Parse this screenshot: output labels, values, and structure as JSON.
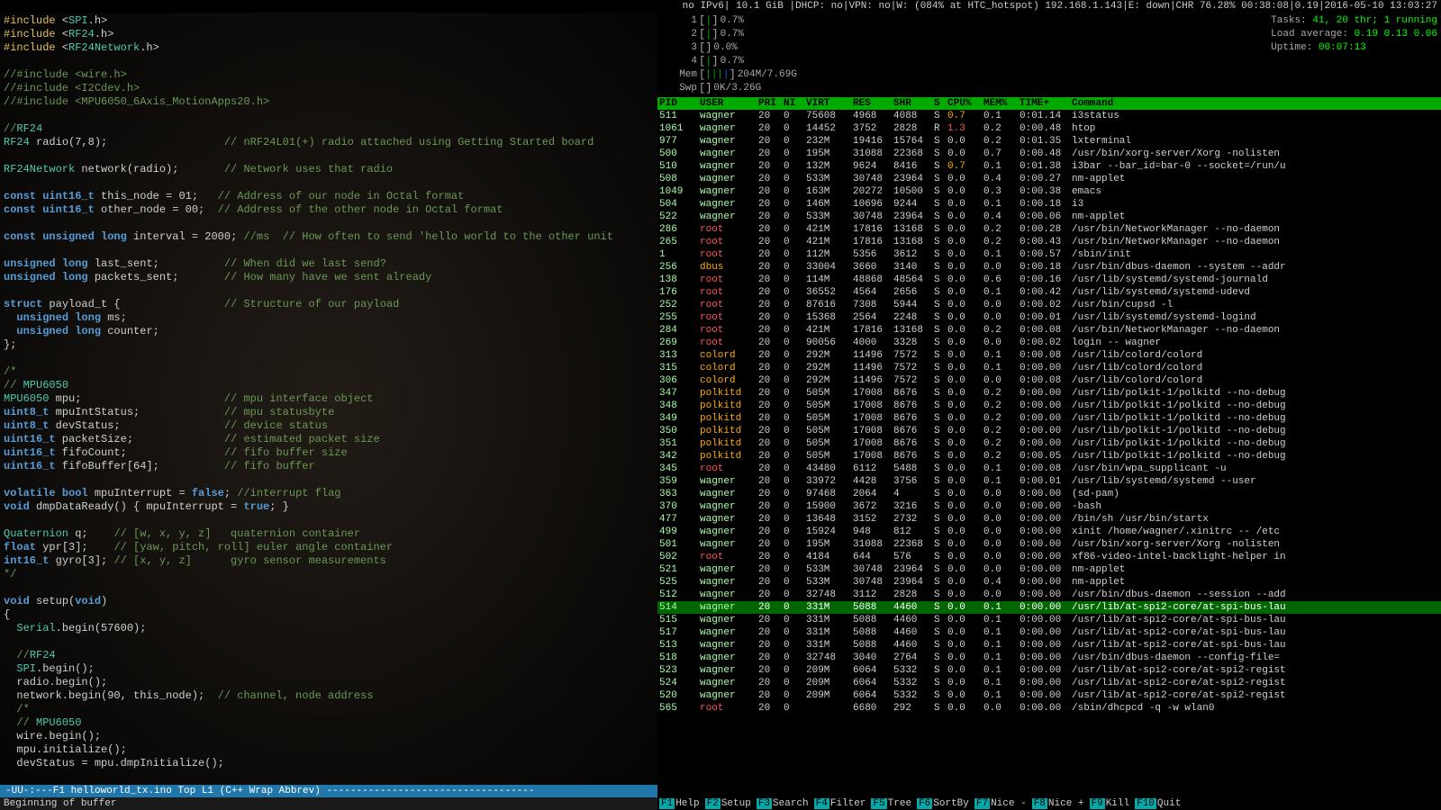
{
  "statusBar": {
    "text": "no IPv6| 10.1 GiB |DHCP: no|VPN: no|W: (084% at HTC_hotspot) 192.168.1.143|E: down|CHR 76.28% 00:38:08|0.19|2016-05-10 13:03:27"
  },
  "htop": {
    "meters": [
      {
        "id": 1,
        "value": "0.7%"
      },
      {
        "id": 2,
        "value": "0.7%"
      },
      {
        "id": 3,
        "value": "0.0%"
      },
      {
        "id": 4,
        "value": "0.7%"
      },
      {
        "mem": "Mem",
        "memVal": "204M/7.69G"
      },
      {
        "swp": "Swp",
        "swpVal": "0K/3.26G"
      }
    ],
    "info": {
      "tasks": "Tasks: 41, 20 thr; 1 running",
      "load": "Load average: 0.19 0.13 0.06",
      "uptime": "Uptime: 00:07:13"
    },
    "columns": [
      "PID",
      "USER",
      "PRI",
      "NI",
      "VIRT",
      "RES",
      "SHR",
      "S",
      "CPU%",
      "MEM%",
      "TIME+",
      "Command"
    ],
    "rows": [
      {
        "pid": "511",
        "user": "wagner",
        "pri": "20",
        "ni": "0",
        "virt": "75608",
        "res": "4968",
        "shr": "4088",
        "s": "S",
        "cpu": "0.7",
        "mem": "0.1",
        "time": "0:01.14",
        "cmd": "i3status"
      },
      {
        "pid": "1061",
        "user": "wagner",
        "pri": "20",
        "ni": "0",
        "virt": "14452",
        "res": "3752",
        "shr": "2828",
        "s": "R",
        "cpu": "1.3",
        "mem": "0.2",
        "time": "0:00.48",
        "cmd": "htop"
      },
      {
        "pid": "977",
        "user": "wagner",
        "pri": "20",
        "ni": "0",
        "virt": "232M",
        "res": "19416",
        "shr": "15764",
        "s": "S",
        "cpu": "0.0",
        "mem": "0.2",
        "time": "0:01.35",
        "cmd": "lxterminal"
      },
      {
        "pid": "500",
        "user": "wagner",
        "pri": "20",
        "ni": "0",
        "virt": "195M",
        "res": "31088",
        "shr": "22368",
        "s": "S",
        "cpu": "0.0",
        "mem": "0.7",
        "time": "0:00.48",
        "cmd": "/usr/bin/xorg-server/Xorg -nolisten"
      },
      {
        "pid": "510",
        "user": "wagner",
        "pri": "20",
        "ni": "0",
        "virt": "132M",
        "res": "9624",
        "shr": "8416",
        "s": "S",
        "cpu": "0.7",
        "mem": "0.1",
        "time": "0:01.38",
        "cmd": "i3bar --bar_id=bar-0 --socket=/run/u"
      },
      {
        "pid": "508",
        "user": "wagner",
        "pri": "20",
        "ni": "0",
        "virt": "533M",
        "res": "30748",
        "shr": "23964",
        "s": "S",
        "cpu": "0.0",
        "mem": "0.4",
        "time": "0:00.27",
        "cmd": "nm-applet"
      },
      {
        "pid": "1049",
        "user": "wagner",
        "pri": "20",
        "ni": "0",
        "virt": "163M",
        "res": "20272",
        "shr": "10500",
        "s": "S",
        "cpu": "0.0",
        "mem": "0.3",
        "time": "0:00.38",
        "cmd": "emacs"
      },
      {
        "pid": "504",
        "user": "wagner",
        "pri": "20",
        "ni": "0",
        "virt": "146M",
        "res": "10696",
        "shr": "9244",
        "s": "S",
        "cpu": "0.0",
        "mem": "0.1",
        "time": "0:00.18",
        "cmd": "i3"
      },
      {
        "pid": "522",
        "user": "wagner",
        "pri": "20",
        "ni": "0",
        "virt": "533M",
        "res": "30748",
        "shr": "23964",
        "s": "S",
        "cpu": "0.0",
        "mem": "0.4",
        "time": "0:00.06",
        "cmd": "nm-applet"
      },
      {
        "pid": "286",
        "user": "root",
        "pri": "20",
        "ni": "0",
        "virt": "421M",
        "res": "17816",
        "shr": "13168",
        "s": "S",
        "cpu": "0.0",
        "mem": "0.2",
        "time": "0:00.28",
        "cmd": "/usr/bin/NetworkManager --no-daemon"
      },
      {
        "pid": "265",
        "user": "root",
        "pri": "20",
        "ni": "0",
        "virt": "421M",
        "res": "17816",
        "shr": "13168",
        "s": "S",
        "cpu": "0.0",
        "mem": "0.2",
        "time": "0:00.43",
        "cmd": "/usr/bin/NetworkManager --no-daemon"
      },
      {
        "pid": "1",
        "user": "root",
        "pri": "20",
        "ni": "0",
        "virt": "112M",
        "res": "5356",
        "shr": "3612",
        "s": "S",
        "cpu": "0.0",
        "mem": "0.1",
        "time": "0:00.57",
        "cmd": "/sbin/init"
      },
      {
        "pid": "256",
        "user": "dbus",
        "pri": "20",
        "ni": "0",
        "virt": "33004",
        "res": "3660",
        "shr": "3140",
        "s": "S",
        "cpu": "0.0",
        "mem": "0.0",
        "time": "0:00.18",
        "cmd": "/usr/bin/dbus-daemon --system --addr"
      },
      {
        "pid": "138",
        "user": "root",
        "pri": "20",
        "ni": "0",
        "virt": "114M",
        "res": "48868",
        "shr": "48564",
        "s": "S",
        "cpu": "0.0",
        "mem": "0.6",
        "time": "0:00.16",
        "cmd": "/usr/lib/systemd/systemd-journald"
      },
      {
        "pid": "176",
        "user": "root",
        "pri": "20",
        "ni": "0",
        "virt": "36552",
        "res": "4564",
        "shr": "2656",
        "s": "S",
        "cpu": "0.0",
        "mem": "0.1",
        "time": "0:00.42",
        "cmd": "/usr/lib/systemd/systemd-udevd"
      },
      {
        "pid": "252",
        "user": "root",
        "pri": "20",
        "ni": "0",
        "virt": "87616",
        "res": "7308",
        "shr": "5944",
        "s": "S",
        "cpu": "0.0",
        "mem": "0.0",
        "time": "0:00.02",
        "cmd": "/usr/bin/cupsd -l"
      },
      {
        "pid": "255",
        "user": "root",
        "pri": "20",
        "ni": "0",
        "virt": "15368",
        "res": "2564",
        "shr": "2248",
        "s": "S",
        "cpu": "0.0",
        "mem": "0.0",
        "time": "0:00.01",
        "cmd": "/usr/lib/systemd/systemd-logind"
      },
      {
        "pid": "284",
        "user": "root",
        "pri": "20",
        "ni": "0",
        "virt": "421M",
        "res": "17816",
        "shr": "13168",
        "s": "S",
        "cpu": "0.0",
        "mem": "0.2",
        "time": "0:00.08",
        "cmd": "/usr/bin/NetworkManager --no-daemon"
      },
      {
        "pid": "269",
        "user": "root",
        "pri": "20",
        "ni": "0",
        "virt": "90056",
        "res": "4000",
        "shr": "3328",
        "s": "S",
        "cpu": "0.0",
        "mem": "0.0",
        "time": "0:00.02",
        "cmd": "login -- wagner"
      },
      {
        "pid": "313",
        "user": "colord",
        "pri": "20",
        "ni": "0",
        "virt": "292M",
        "res": "11496",
        "shr": "7572",
        "s": "S",
        "cpu": "0.0",
        "mem": "0.1",
        "time": "0:00.08",
        "cmd": "/usr/lib/colord/colord"
      },
      {
        "pid": "315",
        "user": "colord",
        "pri": "20",
        "ni": "0",
        "virt": "292M",
        "res": "11496",
        "shr": "7572",
        "s": "S",
        "cpu": "0.0",
        "mem": "0.1",
        "time": "0:00.00",
        "cmd": "/usr/lib/colord/colord"
      },
      {
        "pid": "306",
        "user": "colord",
        "pri": "20",
        "ni": "0",
        "virt": "292M",
        "res": "11496",
        "shr": "7572",
        "s": "S",
        "cpu": "0.0",
        "mem": "0.0",
        "time": "0:00.08",
        "cmd": "/usr/lib/colord/colord"
      },
      {
        "pid": "347",
        "user": "polkitd",
        "pri": "20",
        "ni": "0",
        "virt": "505M",
        "res": "17008",
        "shr": "8676",
        "s": "S",
        "cpu": "0.0",
        "mem": "0.2",
        "time": "0:00.00",
        "cmd": "/usr/lib/polkit-1/polkitd --no-debug"
      },
      {
        "pid": "348",
        "user": "polkitd",
        "pri": "20",
        "ni": "0",
        "virt": "505M",
        "res": "17008",
        "shr": "8676",
        "s": "S",
        "cpu": "0.0",
        "mem": "0.2",
        "time": "0:00.00",
        "cmd": "/usr/lib/polkit-1/polkitd --no-debug"
      },
      {
        "pid": "349",
        "user": "polkitd",
        "pri": "20",
        "ni": "0",
        "virt": "505M",
        "res": "17008",
        "shr": "8676",
        "s": "S",
        "cpu": "0.0",
        "mem": "0.2",
        "time": "0:00.00",
        "cmd": "/usr/lib/polkit-1/polkitd --no-debug"
      },
      {
        "pid": "350",
        "user": "polkitd",
        "pri": "20",
        "ni": "0",
        "virt": "505M",
        "res": "17008",
        "shr": "8676",
        "s": "S",
        "cpu": "0.0",
        "mem": "0.2",
        "time": "0:00.00",
        "cmd": "/usr/lib/polkit-1/polkitd --no-debug"
      },
      {
        "pid": "351",
        "user": "polkitd",
        "pri": "20",
        "ni": "0",
        "virt": "505M",
        "res": "17008",
        "shr": "8676",
        "s": "S",
        "cpu": "0.0",
        "mem": "0.2",
        "time": "0:00.00",
        "cmd": "/usr/lib/polkit-1/polkitd --no-debug"
      },
      {
        "pid": "342",
        "user": "polkitd",
        "pri": "20",
        "ni": "0",
        "virt": "505M",
        "res": "17008",
        "shr": "8676",
        "s": "S",
        "cpu": "0.0",
        "mem": "0.2",
        "time": "0:00.05",
        "cmd": "/usr/lib/polkit-1/polkitd --no-debug"
      },
      {
        "pid": "345",
        "user": "root",
        "pri": "20",
        "ni": "0",
        "virt": "43480",
        "res": "6112",
        "shr": "5488",
        "s": "S",
        "cpu": "0.0",
        "mem": "0.1",
        "time": "0:00.08",
        "cmd": "/usr/bin/wpa_supplicant -u"
      },
      {
        "pid": "359",
        "user": "wagner",
        "pri": "20",
        "ni": "0",
        "virt": "33972",
        "res": "4428",
        "shr": "3756",
        "s": "S",
        "cpu": "0.0",
        "mem": "0.1",
        "time": "0:00.01",
        "cmd": "/usr/lib/systemd/systemd --user"
      },
      {
        "pid": "363",
        "user": "wagner",
        "pri": "20",
        "ni": "0",
        "virt": "97468",
        "res": "2064",
        "shr": "4",
        "s": "S",
        "cpu": "0.0",
        "mem": "0.0",
        "time": "0:00.00",
        "cmd": "(sd-pam)"
      },
      {
        "pid": "370",
        "user": "wagner",
        "pri": "20",
        "ni": "0",
        "virt": "15900",
        "res": "3672",
        "shr": "3216",
        "s": "S",
        "cpu": "0.0",
        "mem": "0.0",
        "time": "0:00.00",
        "cmd": "-bash"
      },
      {
        "pid": "477",
        "user": "wagner",
        "pri": "20",
        "ni": "0",
        "virt": "13648",
        "res": "3152",
        "shr": "2732",
        "s": "S",
        "cpu": "0.0",
        "mem": "0.0",
        "time": "0:00.00",
        "cmd": "/bin/sh /usr/bin/startx"
      },
      {
        "pid": "499",
        "user": "wagner",
        "pri": "20",
        "ni": "0",
        "virt": "15924",
        "res": "948",
        "shr": "812",
        "s": "S",
        "cpu": "0.0",
        "mem": "0.0",
        "time": "0:00.00",
        "cmd": "xinit /home/wagner/.xinitrc -- /etc"
      },
      {
        "pid": "501",
        "user": "wagner",
        "pri": "20",
        "ni": "0",
        "virt": "195M",
        "res": "31088",
        "shr": "22368",
        "s": "S",
        "cpu": "0.0",
        "mem": "0.0",
        "time": "0:00.00",
        "cmd": "/usr/bin/xorg-server/Xorg -nolisten"
      },
      {
        "pid": "502",
        "user": "root",
        "pri": "20",
        "ni": "0",
        "virt": "4184",
        "res": "644",
        "shr": "576",
        "s": "S",
        "cpu": "0.0",
        "mem": "0.0",
        "time": "0:00.00",
        "cmd": "xf86-video-intel-backlight-helper in"
      },
      {
        "pid": "521",
        "user": "wagner",
        "pri": "20",
        "ni": "0",
        "virt": "533M",
        "res": "30748",
        "shr": "23964",
        "s": "S",
        "cpu": "0.0",
        "mem": "0.0",
        "time": "0:00.00",
        "cmd": "nm-applet"
      },
      {
        "pid": "525",
        "user": "wagner",
        "pri": "20",
        "ni": "0",
        "virt": "533M",
        "res": "30748",
        "shr": "23964",
        "s": "S",
        "cpu": "0.0",
        "mem": "0.4",
        "time": "0:00.00",
        "cmd": "nm-applet"
      },
      {
        "pid": "512",
        "user": "wagner",
        "pri": "20",
        "ni": "0",
        "virt": "32748",
        "res": "3112",
        "shr": "2828",
        "s": "S",
        "cpu": "0.0",
        "mem": "0.0",
        "time": "0:00.00",
        "cmd": "/usr/bin/dbus-daemon --session --add"
      },
      {
        "pid": "514",
        "user": "wagner",
        "pri": "20",
        "ni": "0",
        "virt": "331M",
        "res": "5088",
        "shr": "4460",
        "s": "S",
        "cpu": "0.0",
        "mem": "0.1",
        "time": "0:00.00",
        "cmd": "/usr/lib/at-spi2-core/at-spi-bus-lau",
        "highlight": true
      },
      {
        "pid": "515",
        "user": "wagner",
        "pri": "20",
        "ni": "0",
        "virt": "331M",
        "res": "5088",
        "shr": "4460",
        "s": "S",
        "cpu": "0.0",
        "mem": "0.1",
        "time": "0:00.00",
        "cmd": "/usr/lib/at-spi2-core/at-spi-bus-lau"
      },
      {
        "pid": "517",
        "user": "wagner",
        "pri": "20",
        "ni": "0",
        "virt": "331M",
        "res": "5088",
        "shr": "4460",
        "s": "S",
        "cpu": "0.0",
        "mem": "0.1",
        "time": "0:00.00",
        "cmd": "/usr/lib/at-spi2-core/at-spi-bus-lau"
      },
      {
        "pid": "513",
        "user": "wagner",
        "pri": "20",
        "ni": "0",
        "virt": "331M",
        "res": "5088",
        "shr": "4460",
        "s": "S",
        "cpu": "0.0",
        "mem": "0.1",
        "time": "0:00.00",
        "cmd": "/usr/lib/at-spi2-core/at-spi-bus-lau"
      },
      {
        "pid": "518",
        "user": "wagner",
        "pri": "20",
        "ni": "0",
        "virt": "32748",
        "res": "3040",
        "shr": "2764",
        "s": "S",
        "cpu": "0.0",
        "mem": "0.1",
        "time": "0:00.00",
        "cmd": "/usr/bin/dbus-daemon --config-file="
      },
      {
        "pid": "523",
        "user": "wagner",
        "pri": "20",
        "ni": "0",
        "virt": "209M",
        "res": "6064",
        "shr": "5332",
        "s": "S",
        "cpu": "0.0",
        "mem": "0.1",
        "time": "0:00.00",
        "cmd": "/usr/lib/at-spi2-core/at-spi2-regist"
      },
      {
        "pid": "524",
        "user": "wagner",
        "pri": "20",
        "ni": "0",
        "virt": "209M",
        "res": "6064",
        "shr": "5332",
        "s": "S",
        "cpu": "0.0",
        "mem": "0.1",
        "time": "0:00.00",
        "cmd": "/usr/lib/at-spi2-core/at-spi2-regist"
      },
      {
        "pid": "520",
        "user": "wagner",
        "pri": "20",
        "ni": "0",
        "virt": "209M",
        "res": "6064",
        "shr": "5332",
        "s": "S",
        "cpu": "0.0",
        "mem": "0.1",
        "time": "0:00.00",
        "cmd": "/usr/lib/at-spi2-core/at-spi2-regist"
      },
      {
        "pid": "565",
        "user": "root",
        "pri": "20",
        "ni": "0",
        "virt": "",
        "res": "6680",
        "shr": "292",
        "s": "S",
        "cpu": "0.0",
        "mem": "0.0",
        "time": "0:00.00",
        "cmd": "/sbin/dhcpcd -q -w wlan0"
      }
    ],
    "fnKeys": [
      {
        "key": "F1",
        "label": "Help"
      },
      {
        "key": "F2",
        "label": "Setup"
      },
      {
        "key": "F3",
        "label": "Search"
      },
      {
        "key": "F4",
        "label": "Filter"
      },
      {
        "key": "F5",
        "label": "Tree"
      },
      {
        "key": "F6",
        "label": "SortBy"
      },
      {
        "key": "F7",
        "label": "Nice -"
      },
      {
        "key": "F8",
        "label": "Nice +"
      },
      {
        "key": "F9",
        "label": "Kill"
      },
      {
        "key": "F10",
        "label": "Quit"
      }
    ]
  },
  "editor": {
    "modeline": "-UU-:---F1  helloworld_tx.ino  Top L1      (C++ Wrap Abbrev) -----------------------------------",
    "minibuffer": "Beginning of buffer",
    "lines": [
      "#include <SPI.h>",
      "#include <RF24.h>",
      "#include <RF24Network.h>",
      "",
      "//#include <wire.h>",
      "//#include <I2Cdev.h>",
      "//#include <MPU6050_6Axis_MotionApps20.h>",
      "",
      "//RF24",
      "RF24 radio(7,8);                  // nRF24L01(+) radio attached using Getting Started board",
      "",
      "RF24Network network(radio);       // Network uses that radio",
      "",
      "const uint16_t this_node = 01;   // Address of our node in Octal format",
      "const uint16_t other_node = 00;  // Address of the other node in Octal format",
      "",
      "const unsigned long interval = 2000; //ms  // How often to send 'hello world to the other unit",
      "",
      "unsigned long last_sent;          // When did we last send?",
      "unsigned long packets_sent;       // How many have we sent already",
      "",
      "struct payload_t {                // Structure of our payload",
      "  unsigned long ms;",
      "  unsigned long counter;",
      "};",
      "",
      "/*",
      "// MPU6050",
      "MPU6050 mpu;                      // mpu interface object",
      "uint8_t mpuIntStatus;             // mpu statusbyte",
      "uint8_t devStatus;                // device status",
      "uint16_t packetSize;              // estimated packet size",
      "uint16_t fifoCount;               // fifo buffer size",
      "uint16_t fifoBuffer[64];          // fifo buffer",
      "",
      "volatile bool mpuInterrupt = false; //interrupt flag",
      "void dmpDataReady() { mpuInterrupt = true; }",
      "",
      "Quaternion q;    // [w, x, y, z]   quaternion container",
      "float ypr[3];    // [yaw, pitch, roll] euler angle container",
      "int16_t gyro[3]; // [x, y, z]      gyro sensor measurements",
      "*/",
      "",
      "void setup(void)",
      "{",
      "  Serial.begin(57600);",
      "",
      "  //RF24",
      "  SPI.begin();",
      "  radio.begin();",
      "  network.begin(90, this_node);  // channel, node address",
      "  /*",
      "  // MPU6050",
      "  wire.begin();",
      "  mpu.initialize();",
      "  devStatus = mpu.dmpInitialize();"
    ]
  }
}
